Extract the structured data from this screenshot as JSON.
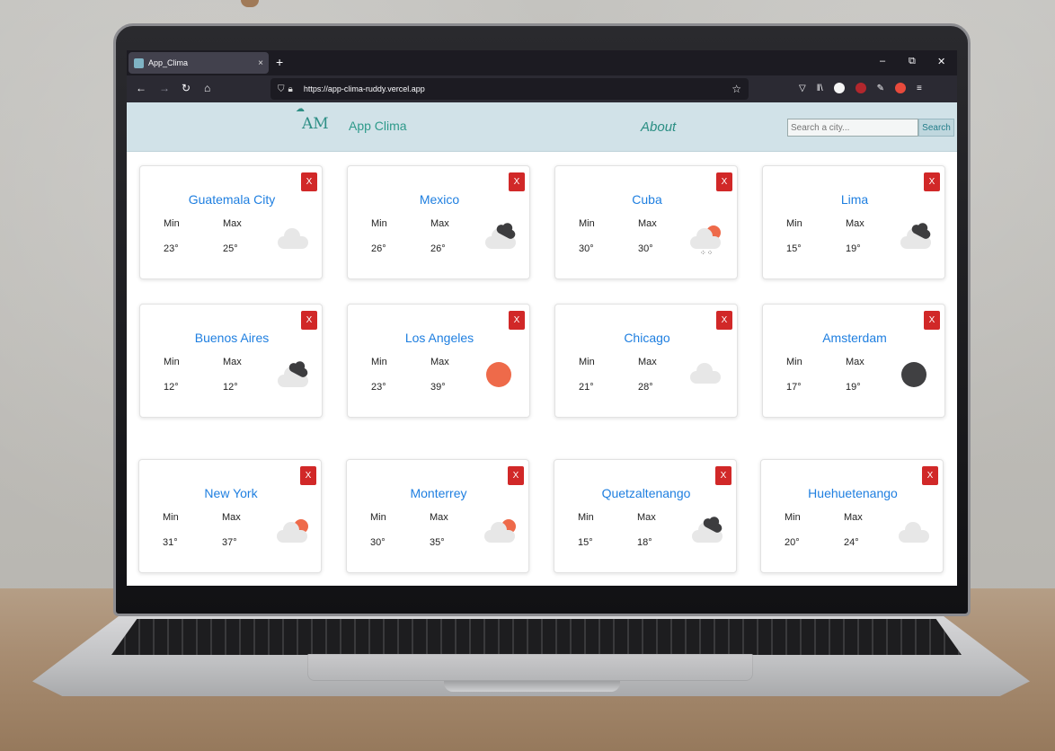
{
  "browser": {
    "tab_title": "App_Clima",
    "tab_close": "×",
    "new_tab": "+",
    "url": "https://app-clima-ruddy.vercel.app",
    "win_minimize": "–",
    "win_restore": "⧉",
    "win_close": "✕"
  },
  "header": {
    "logo_mark": "AM",
    "app_name": "App Clima",
    "about": "About",
    "search_placeholder": "Search a city...",
    "search_button": "Search"
  },
  "labels": {
    "min": "Min",
    "max": "Max",
    "close": "X"
  },
  "cities": [
    {
      "name": "Guatemala City",
      "min": "23°",
      "max": "25°",
      "icon": "cloud-icon"
    },
    {
      "name": "Mexico",
      "min": "26°",
      "max": "26°",
      "icon": "broken-clouds-icon"
    },
    {
      "name": "Cuba",
      "min": "30°",
      "max": "30°",
      "icon": "rain-sun-icon"
    },
    {
      "name": "Lima",
      "min": "15°",
      "max": "19°",
      "icon": "broken-clouds-icon"
    },
    {
      "name": "Buenos Aires",
      "min": "12°",
      "max": "12°",
      "icon": "broken-clouds-icon"
    },
    {
      "name": "Los Angeles",
      "min": "23°",
      "max": "39°",
      "icon": "sun-icon"
    },
    {
      "name": "Chicago",
      "min": "21°",
      "max": "28°",
      "icon": "cloud-icon"
    },
    {
      "name": "Amsterdam",
      "min": "17°",
      "max": "19°",
      "icon": "moon-icon"
    },
    {
      "name": "New York",
      "min": "31°",
      "max": "37°",
      "icon": "partly-cloudy-icon"
    },
    {
      "name": "Monterrey",
      "min": "30°",
      "max": "35°",
      "icon": "partly-cloudy-icon"
    },
    {
      "name": "Quetzaltenango",
      "min": "15°",
      "max": "18°",
      "icon": "broken-clouds-icon"
    },
    {
      "name": "Huehuetenango",
      "min": "20°",
      "max": "24°",
      "icon": "cloud-icon"
    }
  ]
}
